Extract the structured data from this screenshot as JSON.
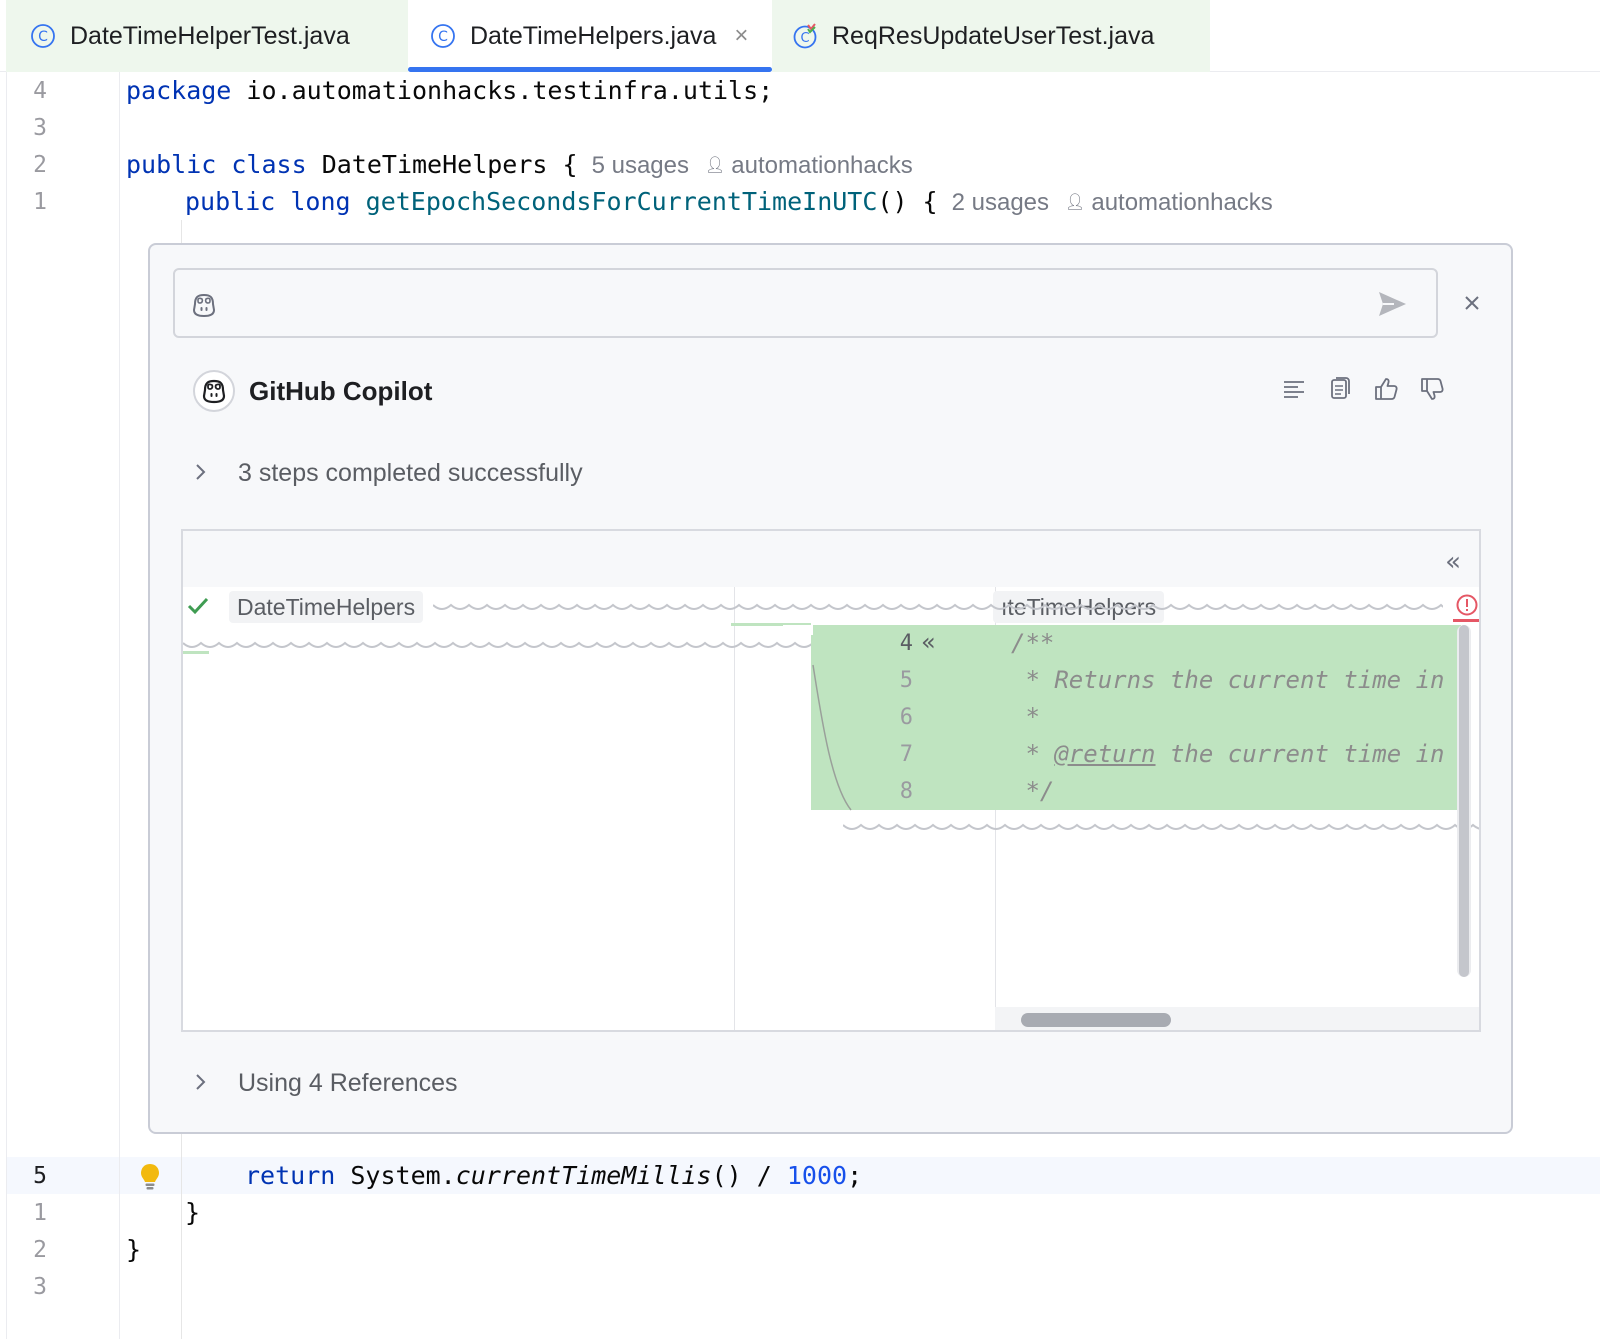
{
  "tabs": [
    {
      "label": "DateTimeHelperTest.java",
      "icon": "class-icon",
      "active": false
    },
    {
      "label": "DateTimeHelpers.java",
      "icon": "class-icon",
      "active": true,
      "close": "×"
    },
    {
      "label": "ReqResUpdateUserTest.java",
      "icon": "test-class-icon",
      "active": false
    }
  ],
  "editor": {
    "line_numbers_top": [
      "4",
      "3",
      "2",
      "1"
    ],
    "line_numbers_bottom": [
      "5",
      "1",
      "2",
      "3"
    ],
    "package_kw": "package",
    "package_name": " io.automationhacks.testinfra.utils;",
    "class_kw1": "public",
    "class_kw2": "class",
    "class_name": " DateTimeHelpers {",
    "class_usages": "5 usages",
    "class_author": "automationhacks",
    "method_kw1": "public",
    "method_kw2": "long",
    "method_name": "getEpochSecondsForCurrentTimeInUTC",
    "method_rest": "() {",
    "method_usages": "2 usages",
    "method_author": "automationhacks",
    "return_kw": "return",
    "return_obj": " System.",
    "return_call": "currentTimeMillis",
    "return_op": "() / ",
    "return_num": "1000",
    "return_end": ";",
    "close_brace_inner": "}",
    "close_brace_outer": "}"
  },
  "copilot": {
    "prompt_value": "",
    "title": "GitHub Copilot",
    "steps_label": "3 steps completed successfully",
    "references_label": "Using 4 References",
    "actions": [
      "insert-icon",
      "copy-icon",
      "thumbs-up-icon",
      "thumbs-down-icon"
    ],
    "diff": {
      "left_file": "DateTimeHelpers",
      "right_file": "ıteTimeHelpers",
      "line_numbers": [
        "4",
        "5",
        "6",
        "7",
        "8"
      ],
      "lines": [
        "/**",
        " * Returns the current time in",
        " *",
        " * @return the current time in",
        " */"
      ],
      "return_tag": "@return",
      "collapse_glyph": "«",
      "merge_glyph": "«"
    }
  },
  "colors": {
    "accent": "#3574f0",
    "diff_added": "#bfe4c0",
    "keyword": "#0033b3",
    "function": "#00627a",
    "number": "#1750eb",
    "error": "#e55765"
  }
}
